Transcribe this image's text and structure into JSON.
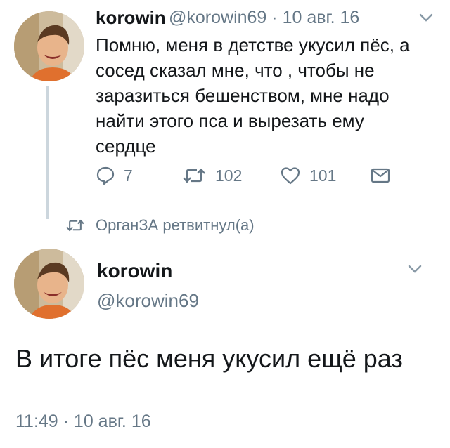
{
  "retweet": {
    "display_name": "korowin",
    "handle": "@korowin69",
    "separator": "·",
    "date": "10 авг. 16",
    "text": "Помню, меня в детстве укусил пёс, а сосед сказал мне, что , чтобы не заразиться бешенством, мне надо найти этого пса и вырезать ему сердце",
    "actions": {
      "reply_count": "7",
      "retweet_count": "102",
      "like_count": "101"
    },
    "icons": {
      "reply": "reply-icon",
      "retweet": "retweet-icon",
      "like": "heart-icon",
      "message": "envelope-icon",
      "menu": "chevron-down-icon"
    }
  },
  "retweet_notice": {
    "text": "ОрганЗА ретвитнул(а)",
    "icon": "retweet-icon"
  },
  "tweet": {
    "display_name": "korowin",
    "handle": "@korowin69",
    "text": "В итоге пёс меня укусил ещё раз",
    "timestamp": "11:49 · 10 авг. 16",
    "icons": {
      "menu": "chevron-down-icon"
    }
  },
  "colors": {
    "text_primary": "#14171a",
    "text_secondary": "#657786",
    "thread_line": "#ccd6dd"
  }
}
